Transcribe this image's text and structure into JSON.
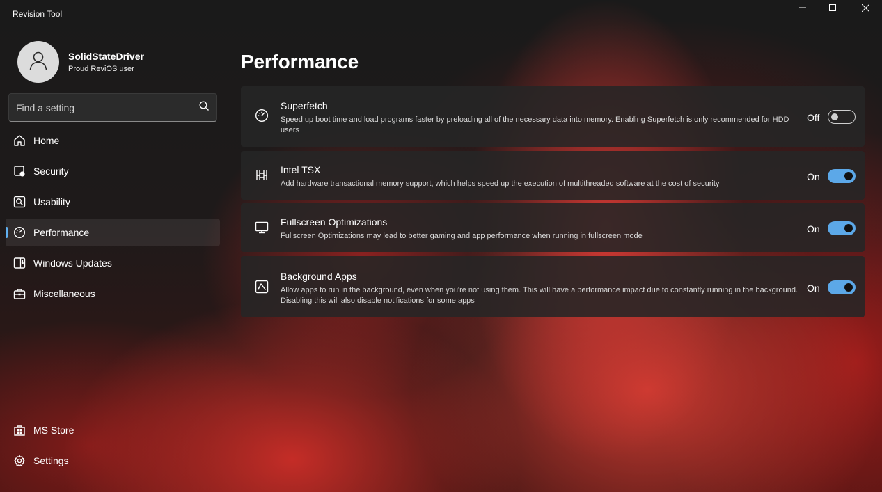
{
  "window": {
    "title": "Revision Tool",
    "controls": {
      "minimize": "minimize-icon",
      "maximize": "maximize-icon",
      "close": "close-icon"
    }
  },
  "profile": {
    "name": "SolidStateDriver",
    "subtitle": "Proud ReviOS user",
    "avatar_icon": "person-icon"
  },
  "search": {
    "placeholder": "Find a setting",
    "value": "",
    "icon": "search-icon"
  },
  "nav": {
    "items": [
      {
        "label": "Home",
        "icon": "home-icon"
      },
      {
        "label": "Security",
        "icon": "shield-icon"
      },
      {
        "label": "Usability",
        "icon": "search-box-icon"
      },
      {
        "label": "Performance",
        "icon": "speedometer-icon",
        "active": true
      },
      {
        "label": "Windows Updates",
        "icon": "update-icon"
      },
      {
        "label": "Miscellaneous",
        "icon": "toolbox-icon"
      }
    ],
    "footer": [
      {
        "label": "MS Store",
        "icon": "store-icon"
      },
      {
        "label": "Settings",
        "icon": "gear-icon"
      }
    ]
  },
  "main": {
    "title": "Performance",
    "settings": [
      {
        "title": "Superfetch",
        "description": "Speed up boot time and load programs faster by preloading all of the necessary data into memory. Enabling Superfetch is only recommended for HDD users",
        "state": "Off",
        "enabled": false,
        "icon": "speedometer-icon"
      },
      {
        "title": "Intel TSX",
        "description": "Add hardware transactional memory support, which helps speed up the execution of multithreaded software at the cost of security",
        "state": "On",
        "enabled": true,
        "icon": "chip-icon"
      },
      {
        "title": "Fullscreen Optimizations",
        "description": "Fullscreen Optimizations may lead to better gaming and app performance when running in fullscreen mode",
        "state": "On",
        "enabled": true,
        "icon": "monitor-icon"
      },
      {
        "title": "Background Apps",
        "description": "Allow apps to run in the background, even when you're not using them. This will have a performance impact due to constantly running in the background. Disabling this will also disable notifications for some apps",
        "state": "On",
        "enabled": true,
        "icon": "activity-icon"
      }
    ]
  },
  "colors": {
    "accent": "#5ca8e8",
    "background_red": "#d63a34",
    "card": "#262626"
  }
}
